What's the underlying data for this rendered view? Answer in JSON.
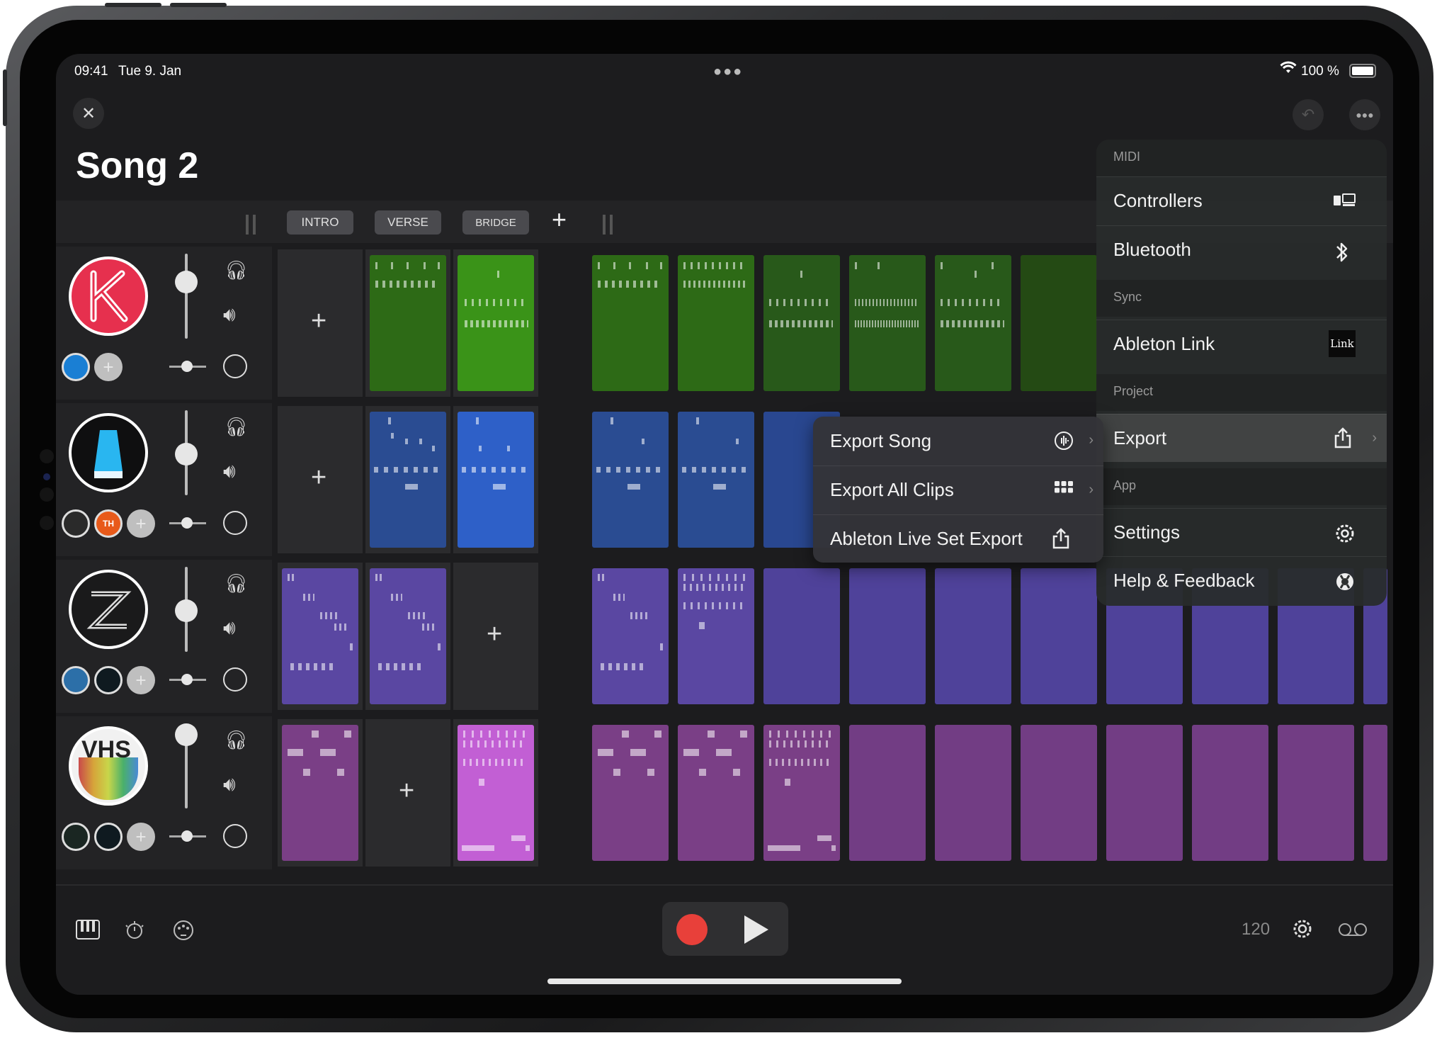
{
  "status_bar": {
    "time": "09:41",
    "date": "Tue 9. Jan",
    "battery": "100 %"
  },
  "song": {
    "title": "Song 2"
  },
  "sections": [
    "INTRO",
    "VERSE",
    "BRIDGE"
  ],
  "tracks": [
    {
      "name": "K",
      "color": "#2f8a12"
    },
    {
      "name": "Cone",
      "color": "#2e5fc8"
    },
    {
      "name": "Z",
      "color": "#5e4aa6"
    },
    {
      "name": "VHS",
      "color": "#8a4a94"
    }
  ],
  "mini_badges": {
    "track2_badge": "TH"
  },
  "transport": {
    "tempo": "120"
  },
  "main_menu": {
    "midi_header": "MIDI",
    "controllers": "Controllers",
    "bluetooth": "Bluetooth",
    "sync_header": "Sync",
    "ableton_link": "Ableton Link",
    "link_badge": "Link",
    "project_header": "Project",
    "export": "Export",
    "app_header": "App",
    "settings": "Settings",
    "help": "Help & Feedback"
  },
  "export_menu": {
    "export_song": "Export Song",
    "export_all_clips": "Export All Clips",
    "ableton_live_set_export": "Ableton Live Set Export"
  },
  "colors": {
    "green": "#2f8a12",
    "blue": "#2e5fc8",
    "purple": "#5e4aa6",
    "magenta": "#8a4a94",
    "record": "#e8403a"
  }
}
